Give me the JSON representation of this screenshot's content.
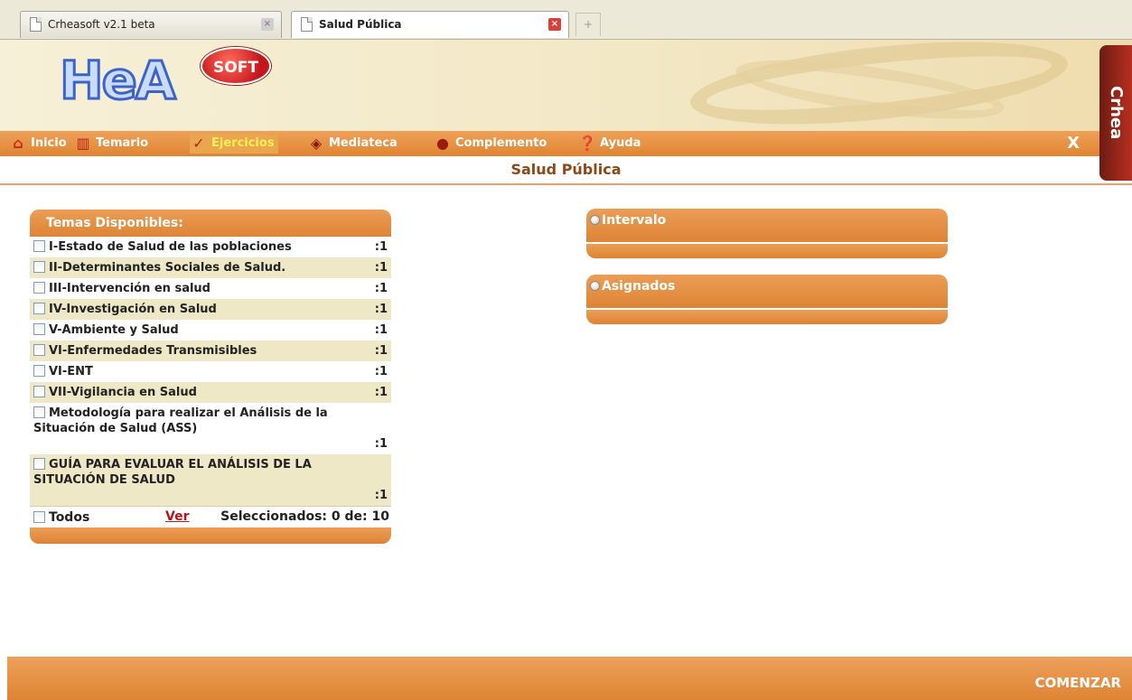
{
  "browser": {
    "tabs": [
      {
        "label": "Crheasoft v2.1 beta",
        "active": false
      },
      {
        "label": "Salud Pública",
        "active": true
      }
    ],
    "new_tab_glyph": "+"
  },
  "logo": {
    "main": "HeA",
    "badge": "SOFT"
  },
  "brand": {
    "label": "Crhea"
  },
  "nav": {
    "items": [
      {
        "label": "Inicio",
        "icon": "home-icon"
      },
      {
        "label": "Temario",
        "icon": "book-icon"
      },
      {
        "label": "Ejercicios",
        "icon": "checkmark-icon",
        "active": true
      },
      {
        "label": "Mediateca",
        "icon": "media-icon"
      },
      {
        "label": "Complemento",
        "icon": "complement-icon"
      },
      {
        "label": "Ayuda",
        "icon": "help-icon"
      }
    ],
    "close_label": "X"
  },
  "page": {
    "title": "Salud Pública"
  },
  "topics_panel": {
    "title": "Temas Disponibles:",
    "items": [
      {
        "label": "I-Estado de Salud de las poblaciones",
        "count": ":1"
      },
      {
        "label": "II-Determinantes Sociales de Salud.",
        "count": ":1"
      },
      {
        "label": "III-Intervención en salud",
        "count": ":1"
      },
      {
        "label": "IV-Investigación en Salud",
        "count": ":1"
      },
      {
        "label": "V-Ambiente y Salud",
        "count": ":1"
      },
      {
        "label": "VI-Enfermedades Transmisibles",
        "count": ":1"
      },
      {
        "label": "VI-ENT",
        "count": ":1"
      },
      {
        "label": "VII-Vigilancia en Salud",
        "count": ":1"
      },
      {
        "label": "Metodología para realizar el Análisis de la Situación de Salud (ASS)",
        "count": ":1"
      },
      {
        "label": "GUÍA PARA EVALUAR EL ANÁLISIS DE LA SITUACIÓN DE SALUD",
        "count": ":1"
      }
    ],
    "select_all_label": "Todos",
    "view_link": "Ver",
    "selected_text": "Seleccionados: 0 de: 10"
  },
  "options": {
    "intervalo_label": "Intervalo",
    "asignados_label": "Asignados"
  },
  "footer": {
    "start_label": "COMENZAR"
  },
  "colors": {
    "accent": "#df8432",
    "title": "#8a4a17",
    "alt_row": "#efe8c6",
    "link": "#b01818"
  }
}
